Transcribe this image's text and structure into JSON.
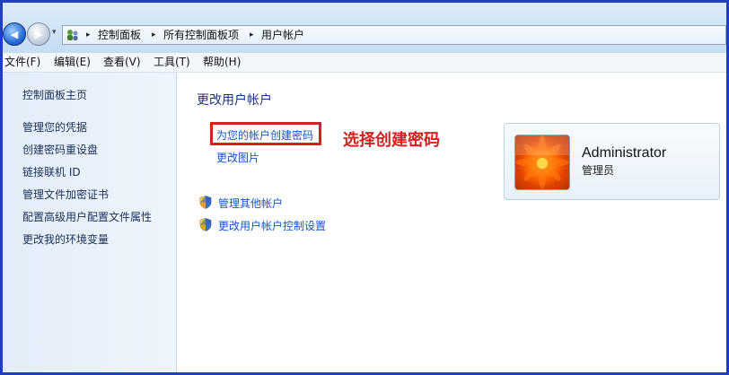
{
  "breadcrumb": {
    "items": [
      "控制面板",
      "所有控制面板项",
      "用户帐户"
    ],
    "separator": "▸"
  },
  "nav": {
    "back_glyph": "◀",
    "forward_glyph": "▶",
    "dropdown_glyph": "▾"
  },
  "menu": {
    "items": [
      "文件(F)",
      "编辑(E)",
      "查看(V)",
      "工具(T)",
      "帮助(H)"
    ]
  },
  "sidebar": {
    "home": "控制面板主页",
    "items": [
      "管理您的凭据",
      "创建密码重设盘",
      "链接联机 ID",
      "管理文件加密证书",
      "配置高级用户配置文件属性",
      "更改我的环境变量"
    ]
  },
  "main": {
    "title": "更改用户帐户",
    "links": {
      "create_password": "为您的帐户创建密码",
      "change_picture": "更改图片",
      "manage_other": "管理其他帐户",
      "uac_settings": "更改用户帐户控制设置"
    },
    "annotation": "选择创建密码"
  },
  "account": {
    "name": "Administrator",
    "role": "管理员"
  },
  "colors": {
    "link": "#1155cc",
    "title": "#1e3287",
    "highlight": "#d32020"
  }
}
